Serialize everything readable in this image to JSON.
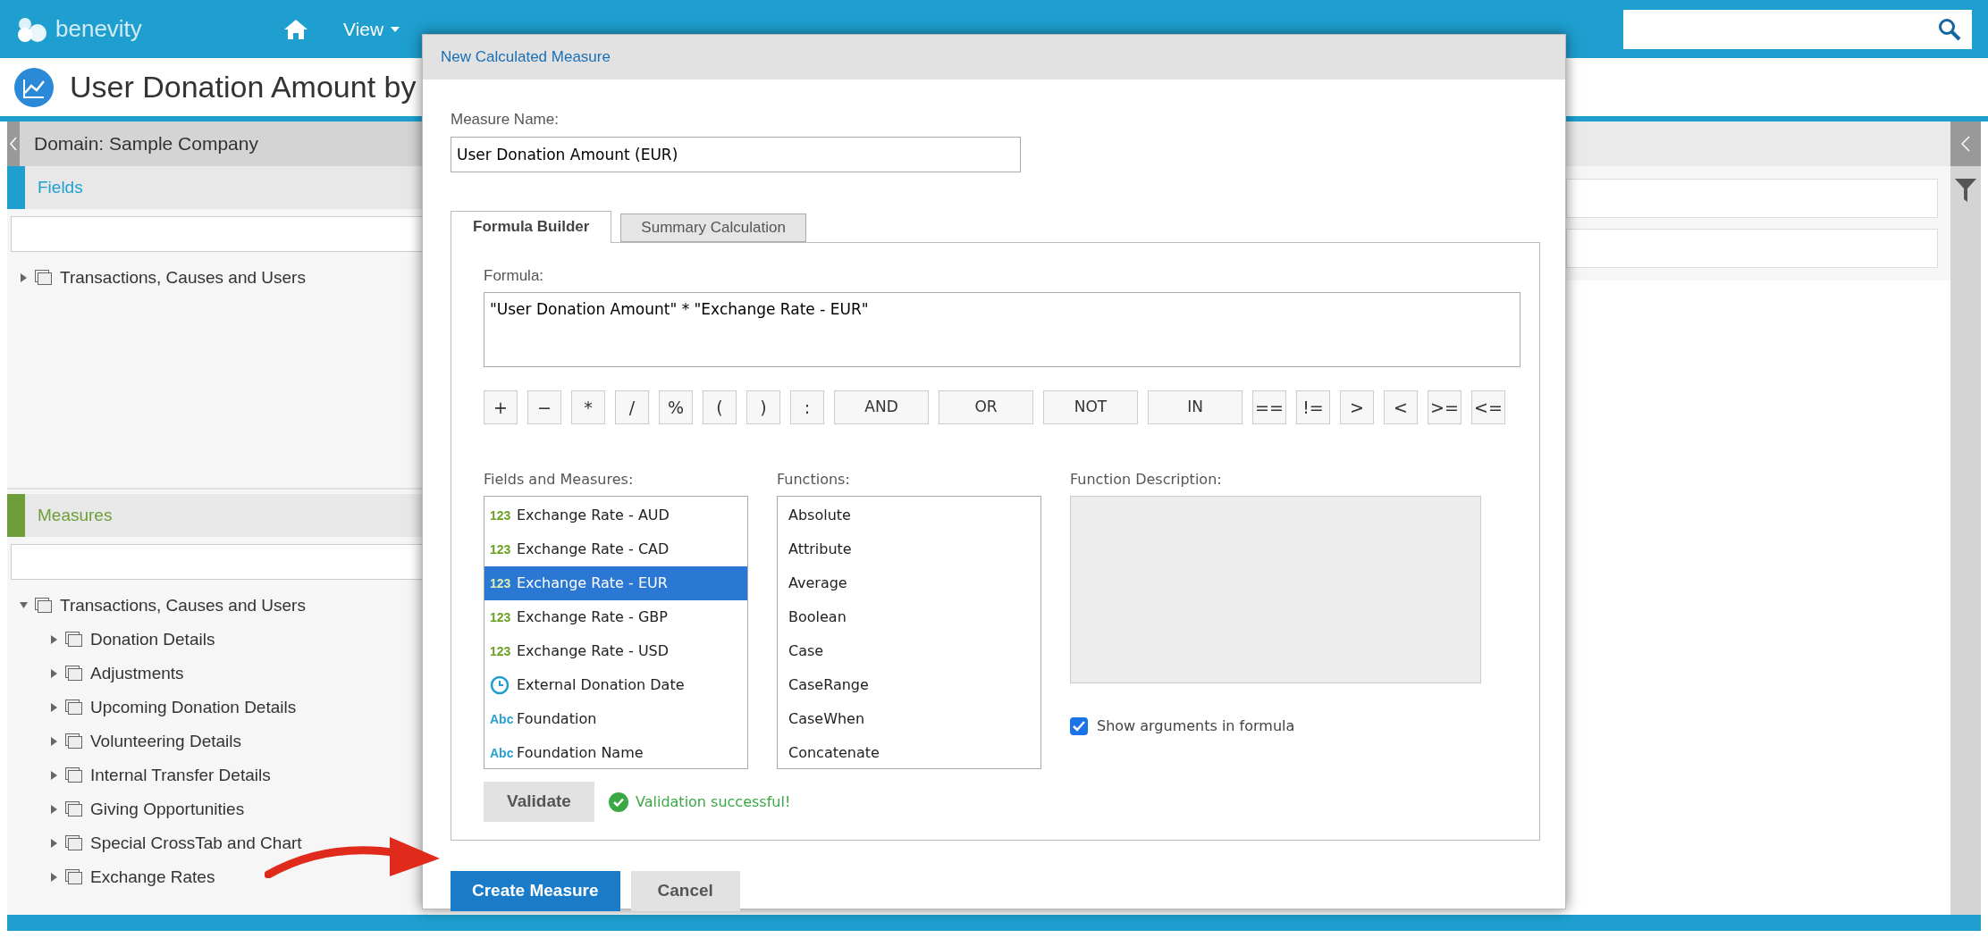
{
  "top_bar": {
    "logo": "benevity",
    "nav": [
      {
        "kind": "home"
      },
      {
        "kind": "menu",
        "label": "View"
      }
    ]
  },
  "page_title": "User Donation Amount by",
  "left_panel": {
    "domain": "Domain: Sample Company",
    "fields": {
      "title": "Fields",
      "tree": [
        {
          "label": "Transactions, Causes and Users",
          "expanded": false
        }
      ]
    },
    "measures": {
      "title": "Measures",
      "tree": [
        {
          "label": "Transactions, Causes and Users",
          "expanded": true,
          "children": [
            {
              "label": "Donation Details",
              "expanded": false
            },
            {
              "label": "Adjustments",
              "expanded": false
            },
            {
              "label": "Upcoming Donation Details",
              "expanded": false
            },
            {
              "label": "Volunteering Details",
              "expanded": false
            },
            {
              "label": "Internal Transfer Details",
              "expanded": false
            },
            {
              "label": "Giving Opportunities",
              "expanded": false
            },
            {
              "label": "Special CrossTab and Chart",
              "expanded": false
            },
            {
              "label": "Exchange Rates",
              "expanded": false
            }
          ]
        }
      ]
    }
  },
  "dialog": {
    "title": "New Calculated Measure",
    "measure_name": {
      "label": "Measure Name:",
      "value": "User Donation Amount (EUR)"
    },
    "tabs": [
      {
        "label": "Formula Builder",
        "selected": true
      },
      {
        "label": "Summary Calculation",
        "selected": false
      }
    ],
    "formula": {
      "label": "Formula:",
      "value": "\"User Donation Amount\" * \"Exchange Rate - EUR\""
    },
    "operators": [
      {
        "kind": "symbol",
        "label": "+"
      },
      {
        "kind": "symbol",
        "label": "−"
      },
      {
        "kind": "symbol",
        "label": "*"
      },
      {
        "kind": "symbol",
        "label": "/"
      },
      {
        "kind": "symbol",
        "label": "%"
      },
      {
        "kind": "symbol",
        "label": "("
      },
      {
        "kind": "symbol",
        "label": ")"
      },
      {
        "kind": "symbol",
        "label": ":"
      },
      {
        "kind": "word",
        "label": "AND"
      },
      {
        "kind": "word",
        "label": "OR"
      },
      {
        "kind": "word",
        "label": "NOT"
      },
      {
        "kind": "word",
        "label": "IN"
      },
      {
        "kind": "symbol",
        "label": "=="
      },
      {
        "kind": "symbol",
        "label": "!="
      },
      {
        "kind": "symbol",
        "label": ">"
      },
      {
        "kind": "symbol",
        "label": "<"
      },
      {
        "kind": "symbol",
        "label": ">="
      },
      {
        "kind": "symbol",
        "label": "<="
      }
    ],
    "fields_and_measures": {
      "label": "Fields and Measures:",
      "items": [
        {
          "kind": "number",
          "badge": "123",
          "label": "Exchange Rate - AUD",
          "selected": false
        },
        {
          "kind": "number",
          "badge": "123",
          "label": "Exchange Rate - CAD",
          "selected": false
        },
        {
          "kind": "number",
          "badge": "123",
          "label": "Exchange Rate - EUR",
          "selected": true
        },
        {
          "kind": "number",
          "badge": "123",
          "label": "Exchange Rate - GBP",
          "selected": false
        },
        {
          "kind": "number",
          "badge": "123",
          "label": "Exchange Rate - USD",
          "selected": false
        },
        {
          "kind": "date",
          "label": "External Donation Date",
          "selected": false
        },
        {
          "kind": "text",
          "badge": "Abc",
          "label": "Foundation",
          "selected": false
        },
        {
          "kind": "text",
          "badge": "Abc",
          "label": "Foundation Name",
          "selected": false
        }
      ]
    },
    "functions": {
      "label": "Functions:",
      "items": [
        {
          "label": "Absolute",
          "selected": false
        },
        {
          "label": "Attribute",
          "selected": false
        },
        {
          "label": "Average",
          "selected": false
        },
        {
          "label": "Boolean",
          "selected": false
        },
        {
          "label": "Case",
          "selected": false
        },
        {
          "label": "CaseRange",
          "selected": false
        },
        {
          "label": "CaseWhen",
          "selected": false
        },
        {
          "label": "Concatenate",
          "selected": false
        }
      ]
    },
    "function_description": {
      "label": "Function Description:"
    },
    "show_arguments": {
      "label": "Show arguments in formula",
      "checked": true
    },
    "validate_button": "Validate",
    "validation": {
      "kind": "success",
      "message": "Validation successful!"
    },
    "buttons": [
      {
        "kind": "primary",
        "label": "Create Measure"
      },
      {
        "kind": "secondary",
        "label": "Cancel"
      }
    ]
  }
}
